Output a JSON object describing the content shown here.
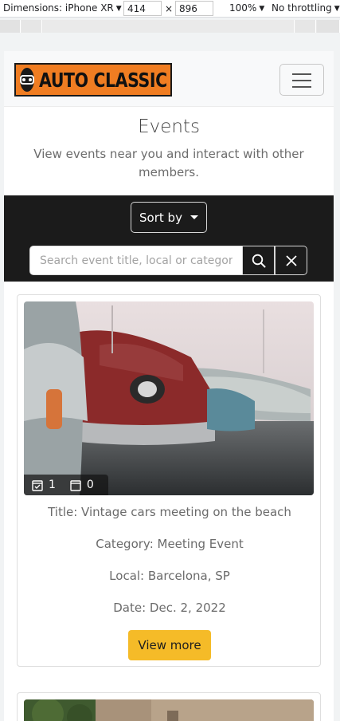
{
  "devtools": {
    "dimensions_label": "Dimensions: iPhone XR",
    "width": "414",
    "height": "896",
    "times": "×",
    "zoom": "100%",
    "throttling": "No throttling"
  },
  "navbar": {
    "logo_text": "AUTO CLASSIC",
    "logo_icon": "car-grille-icon",
    "toggler_icon": "hamburger-icon"
  },
  "page": {
    "title": "Events",
    "subtitle": "View events near you and interact with other members."
  },
  "filters": {
    "sort_label": "Sort by",
    "search_placeholder": "Search event title, local or category",
    "search_icon": "search-icon",
    "clear_icon": "close-icon"
  },
  "events": [
    {
      "attending_count": "1",
      "interested_count": "0",
      "title": "Title: Vintage cars meeting on the beach",
      "category": "Category: Meeting Event",
      "local": "Local: Barcelona, SP",
      "date": "Date: Dec. 2, 2022",
      "button_label": "View more"
    }
  ],
  "colors": {
    "accent": "#f5bb28",
    "logo_bg": "#f07d22",
    "filter_bar": "#1b1b1b"
  }
}
